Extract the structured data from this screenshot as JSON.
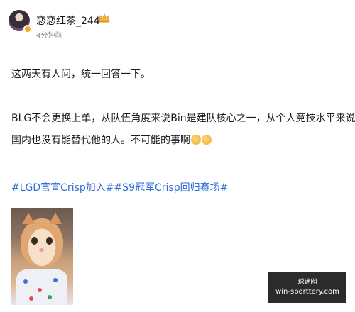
{
  "post": {
    "user": {
      "name": "恋恋红茶_244",
      "timestamp": "4分钟前"
    },
    "text": {
      "line1": "这两天有人问，统一回答一下。",
      "line2": "BLG不会更换上单，从队伍角度来说Bin是建队核心之一，从个人竞技水平来说，",
      "line3": "国内也没有能替代他的人。不可能的事啊"
    },
    "hashtags": "#LGD官宣Crisp加入##S9冠军Crisp回归赛场#",
    "image_alt": "cat photo"
  },
  "watermark": {
    "top": "球迷网",
    "bottom": "win-sporttery.com"
  }
}
